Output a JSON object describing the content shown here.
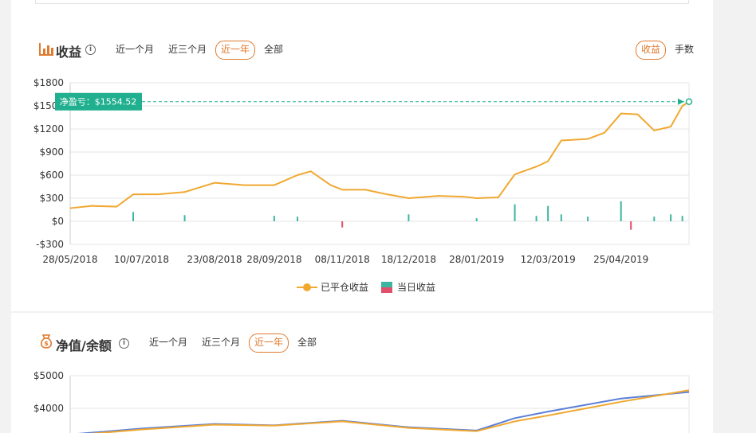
{
  "panel1": {
    "title": "收益",
    "info": "i",
    "tabs": [
      "近一个月",
      "近三个月",
      "近一年",
      "全部"
    ],
    "active_tab": 2,
    "right_tabs": [
      "收益",
      "手数"
    ],
    "active_right_tab": 0,
    "tooltip": "净盈亏：$1554.52",
    "legend": [
      "已平仓收益",
      "当日收益"
    ]
  },
  "panel2": {
    "title": "净值/余额",
    "info": "i",
    "tabs": [
      "近一个月",
      "近三个月",
      "近一年",
      "全部"
    ],
    "active_tab": 2
  },
  "colors": {
    "accent": "#e07a2e",
    "line": "#f0a830",
    "pos_bar": "#3cb5a0",
    "neg_bar": "#e0506a",
    "tooltip_bg": "#21b08f",
    "nav_line": "#5b7fd6"
  },
  "chart_data": [
    {
      "type": "line",
      "title": "",
      "xlabel": "",
      "ylabel": "",
      "ylim": [
        -300,
        1800
      ],
      "y_ticks": [
        "$1800",
        "$1500",
        "$1200",
        "$900",
        "$600",
        "$300",
        "$0",
        "-$300"
      ],
      "x_ticks": [
        "28/05/2018",
        "10/07/2018",
        "23/08/2018",
        "28/09/2018",
        "08/11/2018",
        "18/12/2018",
        "28/01/2019",
        "12/03/2019",
        "25/04/2019"
      ],
      "series": [
        {
          "name": "已平仓收益",
          "x": [
            "28/05/2018",
            "10/06/2018",
            "25/06/2018",
            "05/07/2018",
            "20/07/2018",
            "05/08/2018",
            "23/08/2018",
            "10/09/2018",
            "28/09/2018",
            "12/10/2018",
            "20/10/2018",
            "01/11/2018",
            "08/11/2018",
            "22/11/2018",
            "05/12/2018",
            "18/12/2018",
            "05/01/2019",
            "20/01/2019",
            "28/01/2019",
            "10/02/2019",
            "20/02/2019",
            "05/03/2019",
            "12/03/2019",
            "20/03/2019",
            "05/04/2019",
            "15/04/2019",
            "25/04/2019",
            "05/05/2019",
            "15/05/2019",
            "25/05/2019",
            "01/06/2019",
            "05/06/2019"
          ],
          "values": [
            170,
            200,
            190,
            350,
            350,
            380,
            500,
            470,
            470,
            600,
            650,
            470,
            410,
            410,
            350,
            300,
            330,
            320,
            300,
            310,
            610,
            710,
            780,
            1050,
            1070,
            1150,
            1400,
            1390,
            1180,
            1230,
            1500,
            1554.52
          ]
        },
        {
          "name": "当日收益",
          "type": "bar",
          "x": [
            "05/07/2018",
            "05/08/2018",
            "28/09/2018",
            "12/10/2018",
            "08/11/2018",
            "18/12/2018",
            "28/01/2019",
            "20/02/2019",
            "05/03/2019",
            "12/03/2019",
            "20/03/2019",
            "05/04/2019",
            "25/04/2019",
            "01/05/2019",
            "15/05/2019",
            "25/05/2019",
            "01/06/2019"
          ],
          "values": [
            120,
            80,
            70,
            60,
            -80,
            90,
            40,
            220,
            70,
            200,
            90,
            60,
            260,
            -110,
            60,
            90,
            70
          ]
        }
      ],
      "annotations": [
        "净盈亏：$1554.52"
      ]
    },
    {
      "type": "line",
      "title": "",
      "ylim": [
        3000,
        5000
      ],
      "y_ticks": [
        "$5000",
        "$4000"
      ],
      "series": [
        {
          "name": "",
          "x": [
            "28/05/2018",
            "10/07/2018",
            "23/08/2018",
            "28/09/2018",
            "08/11/2018",
            "18/12/2018",
            "28/01/2019",
            "20/02/2019",
            "12/03/2019",
            "25/04/2019",
            "05/06/2019"
          ],
          "values": [
            3170,
            3350,
            3500,
            3470,
            3600,
            3400,
            3300,
            3600,
            3780,
            4200,
            4554
          ]
        },
        {
          "name": "",
          "x": [
            "28/05/2018",
            "10/07/2018",
            "23/08/2018",
            "28/09/2018",
            "08/11/2018",
            "18/12/2018",
            "28/01/2019",
            "20/02/2019",
            "12/03/2019",
            "25/04/2019",
            "05/06/2019"
          ],
          "values": [
            3200,
            3380,
            3520,
            3480,
            3620,
            3420,
            3320,
            3700,
            3900,
            4300,
            4500
          ]
        }
      ]
    }
  ]
}
